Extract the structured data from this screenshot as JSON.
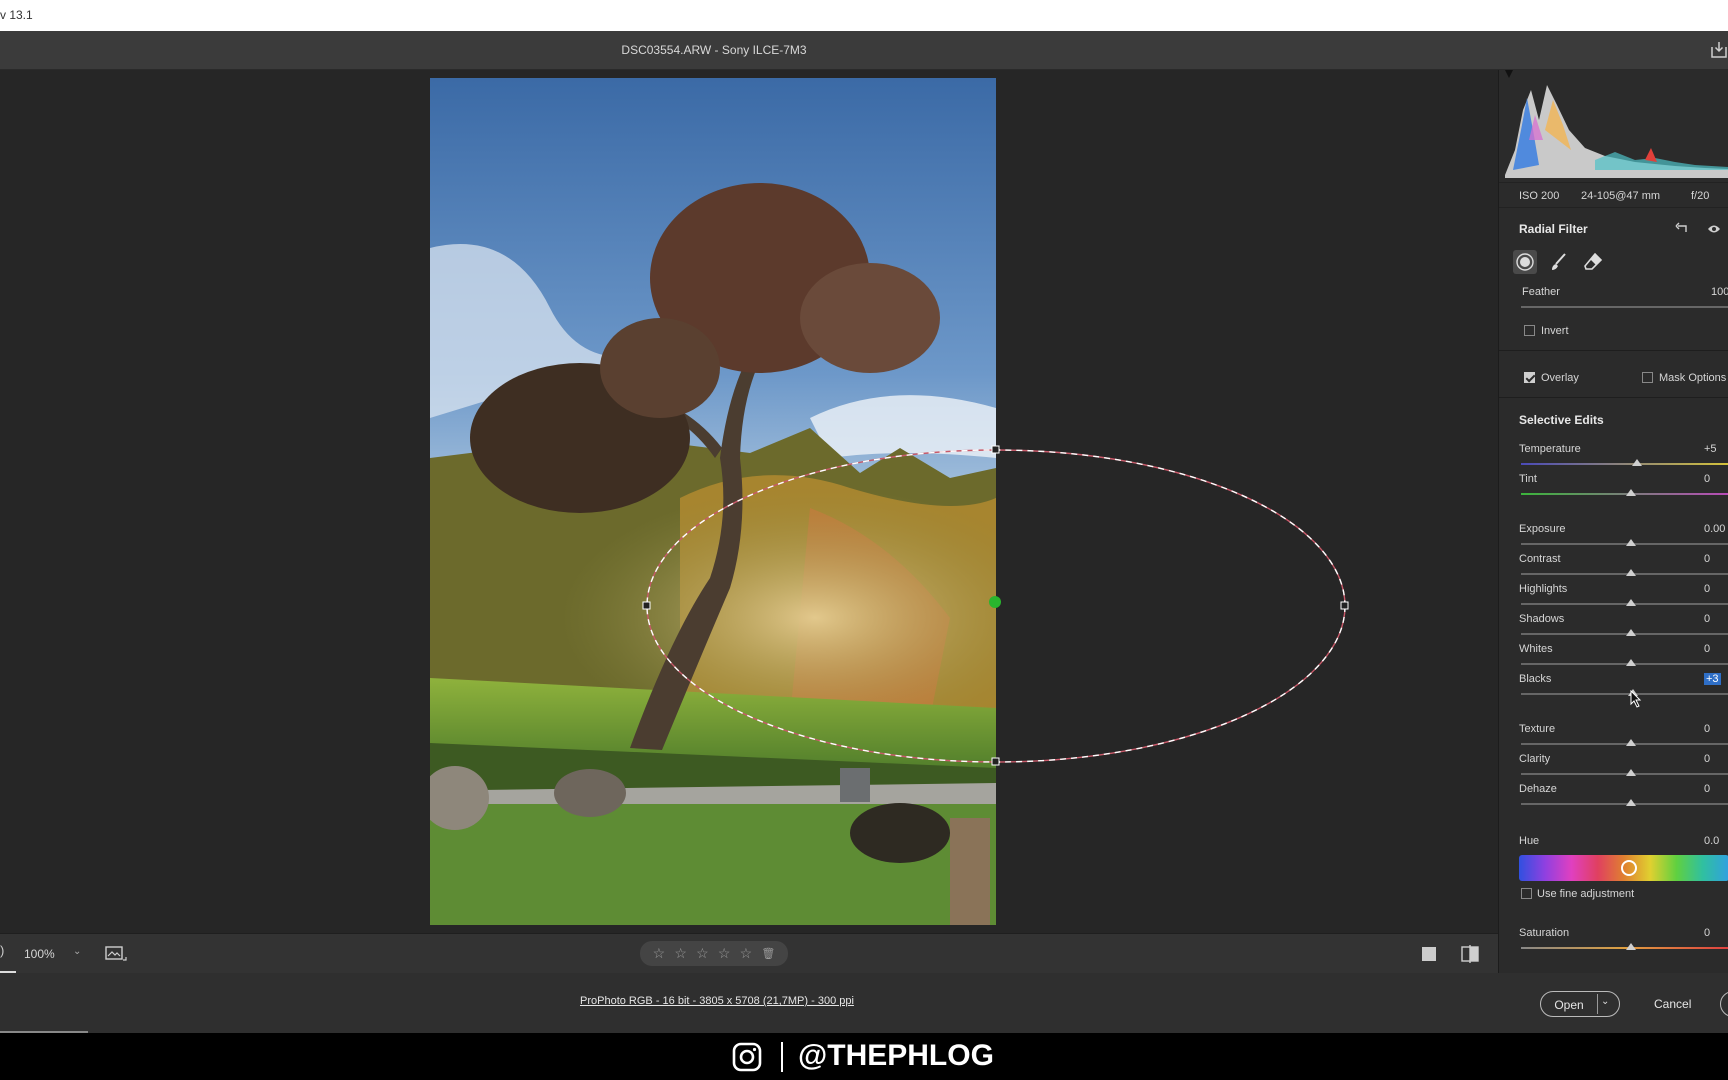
{
  "app": {
    "version_fragment": "v 13.1"
  },
  "header": {
    "file_title": "DSC03554.ARW  -  Sony ILCE-7M3"
  },
  "camera_info": {
    "iso": "ISO 200",
    "lens": "24-105@47 mm",
    "aperture": "f/20"
  },
  "panel": {
    "title": "Radial Filter",
    "feather": {
      "label": "Feather",
      "value": "100"
    },
    "invert_label": "Invert",
    "overlay_label": "Overlay",
    "overlay_checked": true,
    "mask_options_label": "Mask Options",
    "selective_edits_title": "Selective Edits",
    "sliders": [
      {
        "label": "Temperature",
        "value": "+5"
      },
      {
        "label": "Tint",
        "value": "0"
      },
      {
        "label": "Exposure",
        "value": "0.00"
      },
      {
        "label": "Contrast",
        "value": "0"
      },
      {
        "label": "Highlights",
        "value": "0"
      },
      {
        "label": "Shadows",
        "value": "0"
      },
      {
        "label": "Whites",
        "value": "0"
      },
      {
        "label": "Blacks",
        "value": "+3"
      },
      {
        "label": "Texture",
        "value": "0"
      },
      {
        "label": "Clarity",
        "value": "0"
      },
      {
        "label": "Dehaze",
        "value": "0"
      }
    ],
    "hue": {
      "label": "Hue",
      "value": "0.0"
    },
    "fine_adjust_label": "Use fine adjustment",
    "saturation": {
      "label": "Saturation",
      "value": "0"
    }
  },
  "bottom": {
    "zoom_value": "100%",
    "zoom_left_glyph": ")",
    "stars": [
      "☆",
      "☆",
      "☆",
      "☆",
      "☆"
    ],
    "trash_glyph": "🗑"
  },
  "footer": {
    "image_info": "ProPhoto RGB - 16 bit - 3805 x 5708 (21,7MP) - 300 ppi",
    "open_label": "Open",
    "cancel_label": "Cancel"
  },
  "brand": {
    "handle": "@THEPHLOG"
  },
  "colors": {
    "accent": "#2f6fc7",
    "pin": "#29b52e",
    "panel_bg": "#2b2b2b",
    "canvas_bg": "#262626"
  }
}
